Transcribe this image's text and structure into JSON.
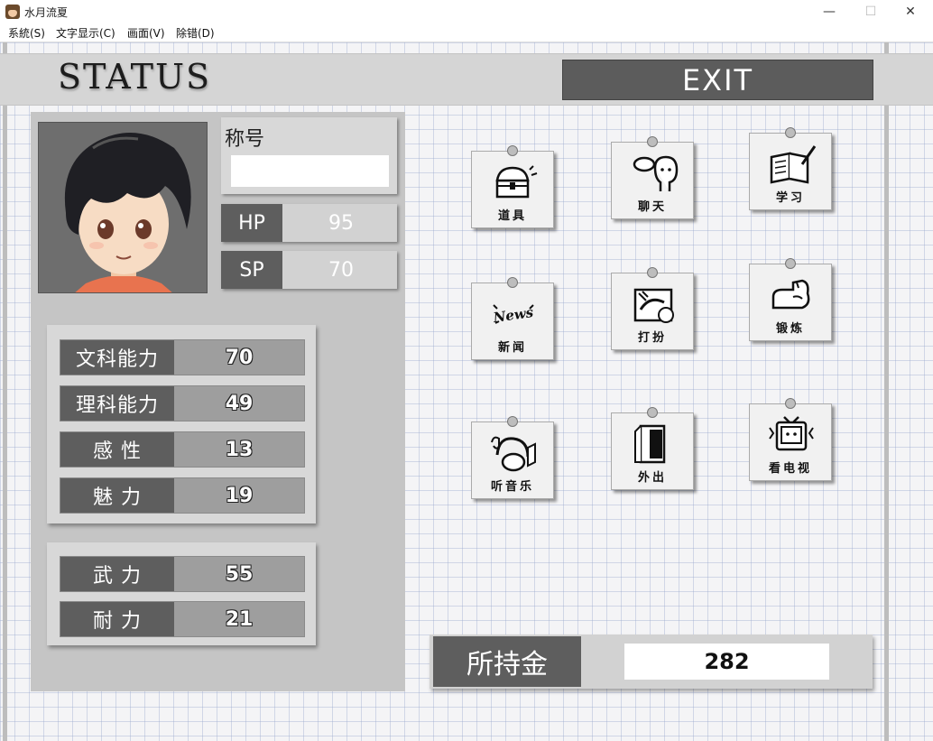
{
  "window": {
    "title": "水月流夏",
    "minimize": "—",
    "maximize": "☐",
    "close": "✕"
  },
  "menu": {
    "system": "系統(S)",
    "text_display": "文字显示(C)",
    "screen": "画面(V)",
    "debug": "除错(D)"
  },
  "header": {
    "title": "STATUS",
    "exit": "EXIT"
  },
  "profile": {
    "title_label": "称号",
    "title_value": ""
  },
  "vitals": {
    "hp_label": "HP",
    "hp": "95",
    "sp_label": "SP",
    "sp": "70"
  },
  "stats": [
    {
      "label": "文科能力",
      "value": "70"
    },
    {
      "label": "理科能力",
      "value": "49"
    },
    {
      "label": "感 性",
      "value": "13"
    },
    {
      "label": "魅 力",
      "value": "19"
    }
  ],
  "combat": [
    {
      "label": "武 力",
      "value": "55"
    },
    {
      "label": "耐 力",
      "value": "21"
    }
  ],
  "commands": [
    {
      "label": "道具",
      "icon": "treasure-chest-icon"
    },
    {
      "label": "聊天",
      "icon": "chat-icon"
    },
    {
      "label": "学习",
      "icon": "study-icon"
    },
    {
      "label": "新闻",
      "icon": "news-icon"
    },
    {
      "label": "打扮",
      "icon": "dress-up-icon"
    },
    {
      "label": "锻炼",
      "icon": "muscle-icon"
    },
    {
      "label": "听音乐",
      "icon": "music-icon"
    },
    {
      "label": "外出",
      "icon": "door-icon"
    },
    {
      "label": "看电视",
      "icon": "tv-icon"
    }
  ],
  "news_icon_text": "News",
  "gold": {
    "label": "所持金",
    "value": "282"
  }
}
